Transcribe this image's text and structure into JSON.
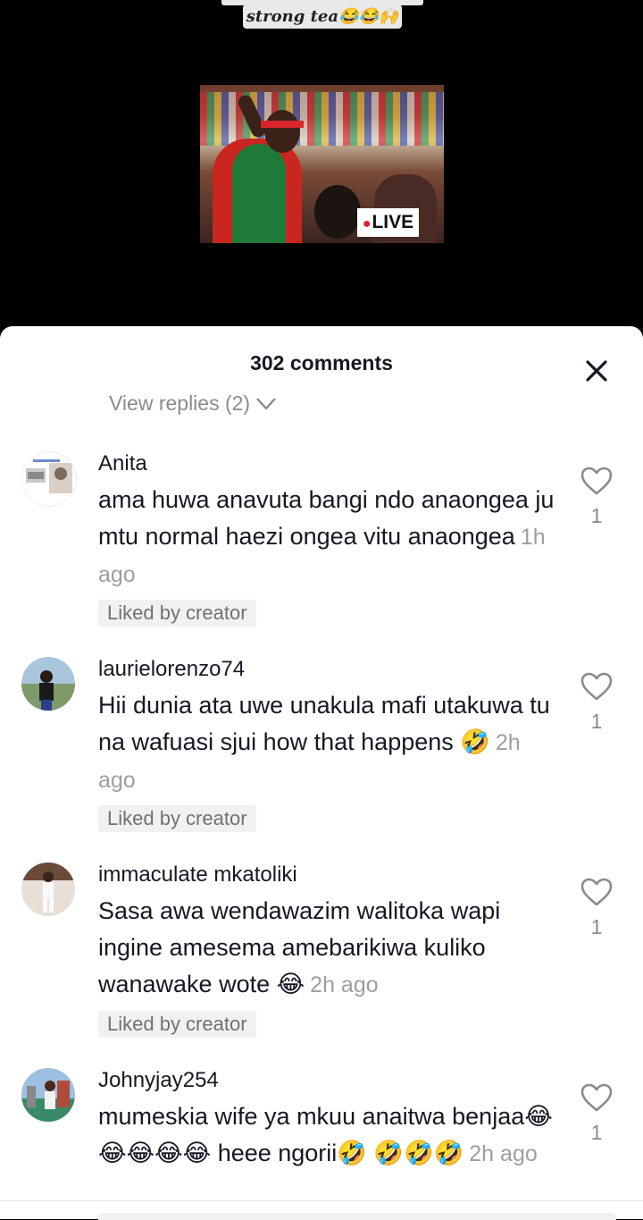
{
  "video": {
    "caption": "strong tea😂😂🙌",
    "live_label": "LIVE"
  },
  "sheet": {
    "title": "302 comments",
    "view_replies": "View replies (2)"
  },
  "comments": [
    {
      "username": "Anita",
      "text": "ama huwa anavuta bangi ndo anaongea ju mtu normal haezi ongea vitu anaongea",
      "time": "1h ago",
      "liked_by_creator": "Liked by creator",
      "likes": "1"
    },
    {
      "username": "laurielorenzo74",
      "text": "Hii dunia ata uwe unakula mafi utakuwa tu na wafuasi sjui how that happens 🤣",
      "time": "2h ago",
      "liked_by_creator": "Liked by creator",
      "likes": "1"
    },
    {
      "username": "immaculate mkatoliki",
      "text": "Sasa awa wendawazim walitoka wapi ingine amesema amebarikiwa kuliko wanawake wote 😂",
      "time": "2h ago",
      "liked_by_creator": "Liked by creator",
      "likes": "1"
    },
    {
      "username": "Johnyjay254",
      "text": "mumeskia wife ya mkuu anaitwa benjaa😂😂😂😂😂 heee ngorii🤣 🤣🤣🤣",
      "time": "2h ago",
      "likes": "1"
    }
  ]
}
